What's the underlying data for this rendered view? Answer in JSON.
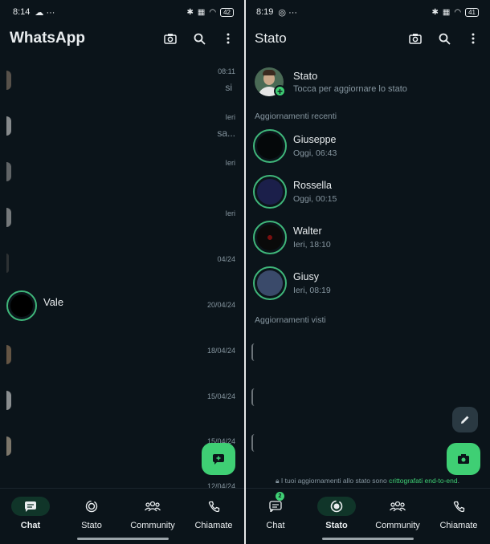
{
  "left": {
    "statusbar": {
      "time": "8:14",
      "extra": "☁ ···",
      "battery": "42"
    },
    "appbar": {
      "title": "WhatsApp"
    },
    "chats": [
      {
        "time": "08:11",
        "snippet": "si"
      },
      {
        "time": "Ieri",
        "snippet": "sa..."
      },
      {
        "time": "Ieri",
        "snippet": ""
      },
      {
        "time": "Ieri",
        "snippet": ""
      },
      {
        "time": "04/24",
        "snippet": ""
      },
      {
        "time": "20/04/24",
        "name": "Vale"
      },
      {
        "time": "18/04/24",
        "snippet": ""
      },
      {
        "time": "15/04/24",
        "snippet": ""
      },
      {
        "time": "15/04/24",
        "snippet": ""
      },
      {
        "time": "12/04/24",
        "snippet": ""
      }
    ],
    "nav": [
      {
        "label": "Chat",
        "icon": "chat-icon",
        "active": true
      },
      {
        "label": "Stato",
        "icon": "status-icon",
        "active": false
      },
      {
        "label": "Community",
        "icon": "community-icon",
        "active": false
      },
      {
        "label": "Chiamate",
        "icon": "phone-icon",
        "active": false
      }
    ]
  },
  "right": {
    "statusbar": {
      "time": "8:19",
      "extra": "◎ ···",
      "battery": "41"
    },
    "appbar": {
      "title": "Stato"
    },
    "my_status": {
      "name": "Stato",
      "subtitle": "Tocca per aggiornare lo stato"
    },
    "recent_header": "Aggiornamenti recenti",
    "recent": [
      {
        "name": "Giuseppe",
        "time": "Oggi, 06:43"
      },
      {
        "name": "Rossella",
        "time": "Oggi, 00:15"
      },
      {
        "name": "Walter",
        "time": "Ieri, 18:10"
      },
      {
        "name": "Giusy",
        "time": "Ieri, 08:19"
      }
    ],
    "seen_header": "Aggiornamenti visti",
    "encryption": {
      "prefix": "I tuoi aggiornamenti allo stato sono ",
      "link": "crittografati end-to-end",
      "suffix": "."
    },
    "chat_badge": "2",
    "nav": [
      {
        "label": "Chat",
        "icon": "chat-icon",
        "active": false
      },
      {
        "label": "Stato",
        "icon": "status-icon",
        "active": true
      },
      {
        "label": "Community",
        "icon": "community-icon",
        "active": false
      },
      {
        "label": "Chiamate",
        "icon": "phone-icon",
        "active": false
      }
    ]
  },
  "colors": {
    "background": "#0b141a",
    "accent": "#3fcf74",
    "muted": "#8696a0"
  }
}
